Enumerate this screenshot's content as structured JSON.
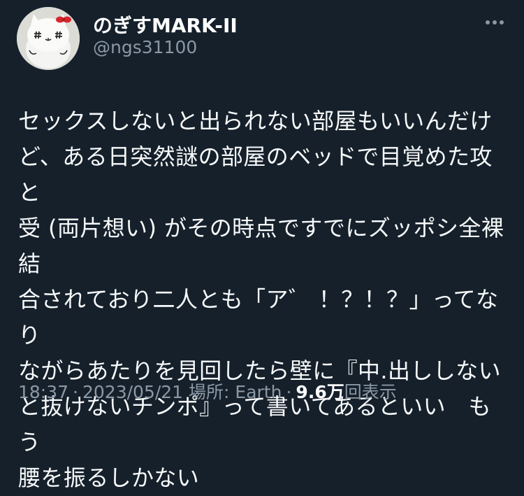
{
  "user": {
    "display_name": "のぎすMARK-II",
    "handle": "@ngs31100"
  },
  "tweet": {
    "lines": [
      "セックスしないと出られない部屋もいいんだけ",
      "ど、ある日突然謎の部屋のベッドで目覚めた攻と",
      "受 (両片想い) がその時点ですでにズッポシ全裸結",
      "合されており二人とも「ア゛ ！？！？」ってなり",
      "ながらあたりを見回したら壁に『中.出ししない",
      "と抜けないチンポ』って書いてあるといい　もう",
      "腰を振るしかない"
    ]
  },
  "meta": {
    "time": "18:37",
    "separator": "·",
    "date": "2023/05/21",
    "location_label": "場所: Earth",
    "views_count": "9.6万",
    "views_label": "回表示"
  },
  "colors": {
    "background": "#15202b",
    "text": "#f7f9f9",
    "secondary": "#8b98a5"
  },
  "icons": {
    "avatar": "white-cat-plush-with-red-bow",
    "more": "more-horizontal-icon"
  }
}
